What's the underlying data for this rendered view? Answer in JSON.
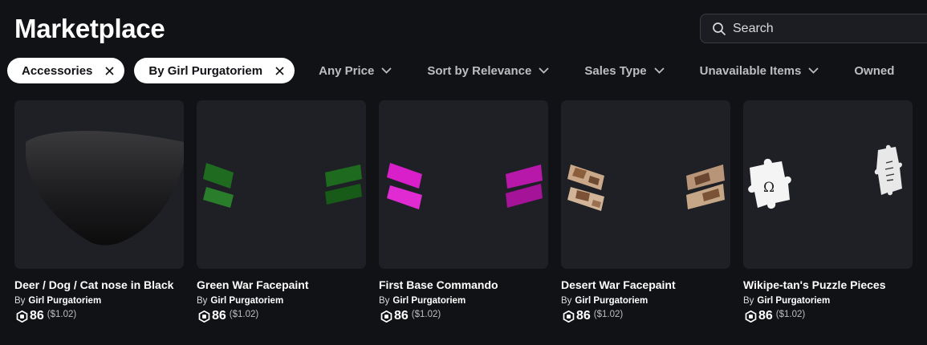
{
  "header": {
    "title": "Marketplace",
    "search": {
      "placeholder": "Search",
      "value": ""
    }
  },
  "filters": {
    "chips": [
      {
        "label": "Accessories"
      },
      {
        "label": "By Girl Purgatoriem"
      }
    ],
    "dropdowns": [
      {
        "label": "Any Price"
      },
      {
        "label": "Sort by Relevance"
      },
      {
        "label": "Sales Type"
      },
      {
        "label": "Unavailable Items"
      },
      {
        "label": "Owned"
      }
    ]
  },
  "items": [
    {
      "name": "Deer / Dog / Cat nose in Black",
      "by": "By",
      "creator": "Girl Purgatoriem",
      "price": "86",
      "usd": "($1.02)"
    },
    {
      "name": "Green War Facepaint",
      "by": "By",
      "creator": "Girl Purgatoriem",
      "price": "86",
      "usd": "($1.02)"
    },
    {
      "name": "First Base Commando",
      "by": "By",
      "creator": "Girl Purgatoriem",
      "price": "86",
      "usd": "($1.02)"
    },
    {
      "name": "Desert War Facepaint",
      "by": "By",
      "creator": "Girl Purgatoriem",
      "price": "86",
      "usd": "($1.02)"
    },
    {
      "name": "Wikipe-tan's Puzzle Pieces",
      "by": "By",
      "creator": "Girl Purgatoriem",
      "price": "86",
      "usd": "($1.02)"
    }
  ],
  "icons": {
    "search": "search-icon",
    "chip_close": "close-icon",
    "dropdown": "chevron-down-icon",
    "currency": "robux-icon"
  },
  "colors": {
    "background": "#111216",
    "card": "#1f2026",
    "chip": "#ffffff",
    "dropdown_text": "#bdbec1",
    "green_paint": "#1f6b1f",
    "pink_paint": "#d21cc4"
  }
}
